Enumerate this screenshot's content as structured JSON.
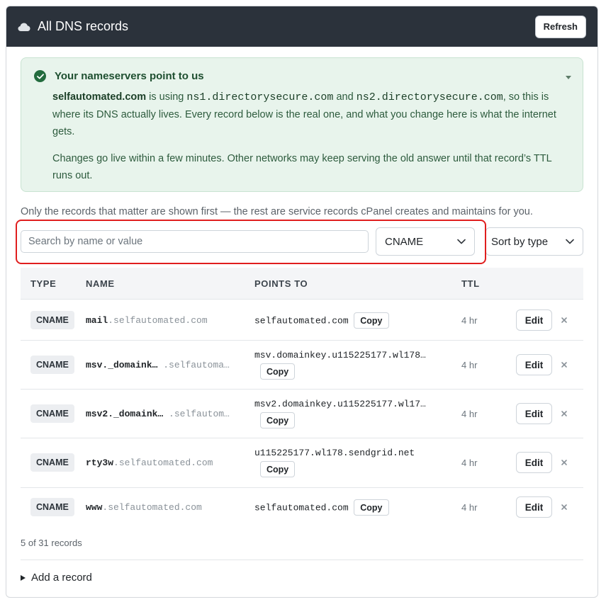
{
  "header": {
    "title": "All DNS records",
    "refresh_label": "Refresh",
    "icon": "cloud-icon"
  },
  "alert": {
    "title": "Your nameservers point to us",
    "domain": "selfautomated.com",
    "text_is_using": " is using ",
    "ns1": "ns1.directorysecure.com",
    "text_and": " and ",
    "ns2": "ns2.directorysecure.com",
    "text_rest": ", so this is where its DNS actually lives. Every record below is the real one, and what you change here is what the internet gets.",
    "paragraph2": "Changes go live within a few minutes. Other networks may keep serving the old answer until that record’s TTL runs out.",
    "status_color": "#236c3e"
  },
  "note": "Only the records that matter are shown first — the rest are service records cPanel creates and maintains for you.",
  "filters": {
    "search_placeholder": "Search by name or value",
    "search_value": "",
    "type_selected": "CNAME",
    "sort_selected": "Sort by type"
  },
  "table": {
    "headers": {
      "type": "TYPE",
      "name": "NAME",
      "value": "POINTS TO",
      "ttl": "TTL"
    },
    "rows": [
      {
        "type": "CNAME",
        "host": "mail",
        "domain": ".selfautomated.com",
        "value": "selfautomated.com",
        "ttl": "4 hr"
      },
      {
        "type": "CNAME",
        "host": "msv._domaink…",
        "domain": ".selfautoma…",
        "value": "msv.domainkey.u115225177.wl178…",
        "ttl": "4 hr"
      },
      {
        "type": "CNAME",
        "host": "msv2._domaink…",
        "domain": ".selfautom…",
        "value": "msv2.domainkey.u115225177.wl17…",
        "ttl": "4 hr"
      },
      {
        "type": "CNAME",
        "host": "rty3w",
        "domain": ".selfautomated.com",
        "value": "u115225177.wl178.sendgrid.net",
        "ttl": "4 hr"
      },
      {
        "type": "CNAME",
        "host": "www",
        "domain": ".selfautomated.com",
        "value": "selfautomated.com",
        "ttl": "4 hr"
      }
    ],
    "copy_label": "Copy",
    "edit_label": "Edit"
  },
  "count": "5 of 31 records",
  "add_record": "Add a record",
  "colors": {
    "header_bg": "#2b323b",
    "alert_bg": "#e8f4ec",
    "highlight": "#e01e1e"
  }
}
